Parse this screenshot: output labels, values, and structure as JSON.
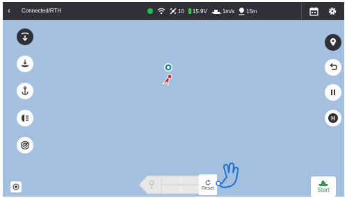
{
  "topbar": {
    "back_icon": "chevron-left-icon",
    "title": "Connected/RTH",
    "satellites": "10",
    "voltage": "15.9V",
    "speed": "1m/s",
    "distance": "15m",
    "status_color": "#27c24c"
  },
  "slider": {
    "upper": "2",
    "lower": "1"
  },
  "reset": {
    "label": "Reset"
  },
  "start": {
    "label": "Start"
  },
  "right_buttons": {
    "hold_label": "H"
  }
}
